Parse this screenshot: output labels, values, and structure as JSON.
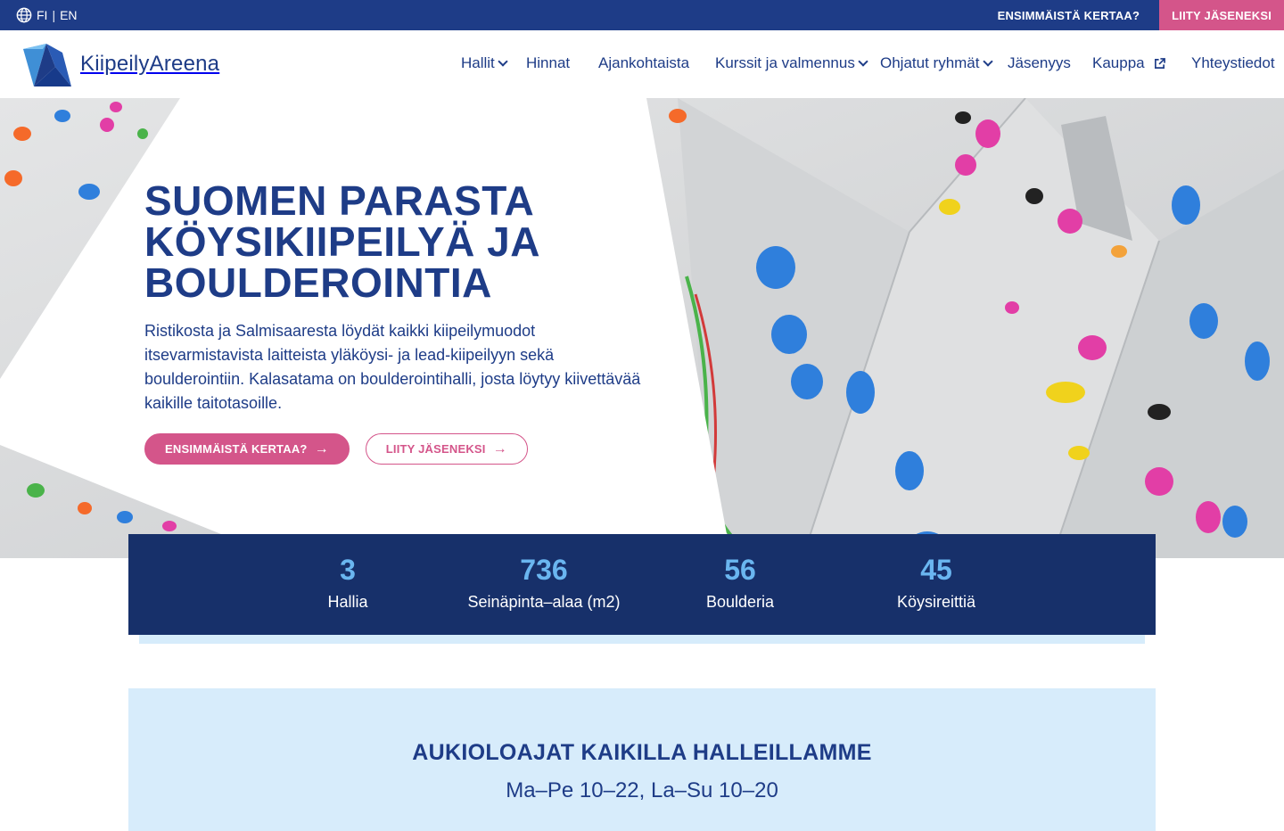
{
  "topbar": {
    "lang_fi": "FI",
    "lang_sep": "|",
    "lang_en": "EN",
    "first_time": "ENSIMMÄISTÄ KERTAA?",
    "join": "LIITY JÄSENEKSI"
  },
  "header": {
    "logo_text": "KiipeilyAreena",
    "nav": [
      {
        "label": "Hallit",
        "dropdown": true
      },
      {
        "label": "Hinnat"
      },
      {
        "label": "Ajankohtaista"
      },
      {
        "label": "Kurssit ja valmennus",
        "dropdown": true
      },
      {
        "label": "Ohjatut ryhmät",
        "dropdown": true
      },
      {
        "label": "Jäsenyys"
      },
      {
        "label": "Kauppa",
        "external": true
      },
      {
        "label": "Yhteystiedot"
      }
    ]
  },
  "hero": {
    "title_line1": "SUOMEN PARASTA",
    "title_line2": "KÖYSIKIIPEILYÄ JA",
    "title_line3": "BOULDEROINTIA",
    "text": "Ristikosta ja Salmisaaresta löydät kaikki kiipeilymuodot itsevarmistavista laitteista yläköysi- ja lead-kiipeilyyn sekä boulderointiin. Kalasatama on boulderointihalli, josta löytyy kiivettävää kaikille taitotasoille.",
    "btn_first": "ENSIMMÄISTÄ KERTAA?",
    "btn_join": "LIITY JÄSENEKSI",
    "arrow": "→"
  },
  "stats": [
    {
      "num": "3",
      "label": "Hallia"
    },
    {
      "num": "736",
      "label": "Seinäpinta–alaa (m2)"
    },
    {
      "num": "56",
      "label": "Boulderia"
    },
    {
      "num": "45",
      "label": "Köysireittiä"
    }
  ],
  "hours": {
    "title": "AUKIOLOAJAT KAIKILLA HALLEILLAMME",
    "text": "Ma–Pe 10–22, La–Su 10–20"
  },
  "colors": {
    "brand_blue": "#1e3c87",
    "dark_blue": "#17306a",
    "accent_pink": "#d4558a",
    "light_blue": "#d7ecfb",
    "stat_number": "#6ab6f0"
  }
}
